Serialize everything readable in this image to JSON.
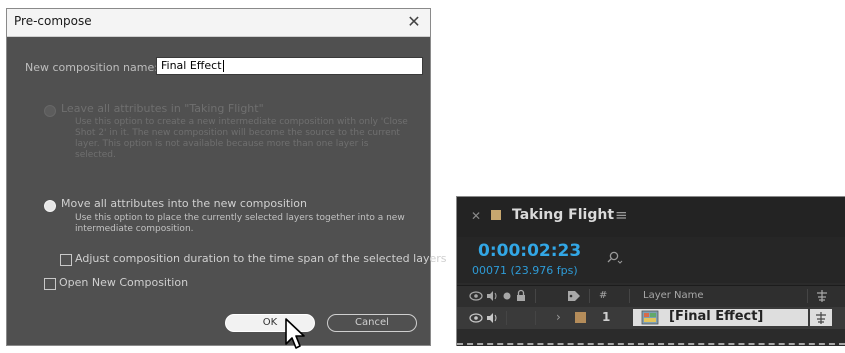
{
  "dialog": {
    "title": "Pre-compose",
    "name_label": "New composition name:",
    "name_value": "Final Effect",
    "option_leave": {
      "label": "Leave all attributes in \"Taking Flight\"",
      "description": "Use this option to create a new intermediate composition with only 'Close Shot 2' in it. The new composition will become the source to the current layer. This option is not available because more than one layer is selected.",
      "enabled": false,
      "selected": false
    },
    "option_move": {
      "label": "Move all attributes into the new composition",
      "description": "Use this option to place the currently selected layers together into a new intermediate composition.",
      "enabled": true,
      "selected": true
    },
    "adjust_duration_label": "Adjust composition duration to the time span of the selected layers",
    "adjust_duration_checked": false,
    "open_new_label": "Open New Composition",
    "open_new_checked": false,
    "ok_label": "OK",
    "cancel_label": "Cancel"
  },
  "timeline": {
    "comp_name": "Taking Flight",
    "timecode": "0:00:02:23",
    "frames_fps": "00071 (23.976 fps)",
    "search_placeholder": "",
    "columns": {
      "number": "#",
      "layer_name": "Layer Name"
    },
    "layer": {
      "number": "1",
      "name": "[Final Effect]",
      "label_color": "#b48c5a"
    }
  },
  "colors": {
    "dialog_bg": "#505050",
    "timecode_blue": "#32a7e6",
    "comp_swatch": "#c7a76f"
  }
}
